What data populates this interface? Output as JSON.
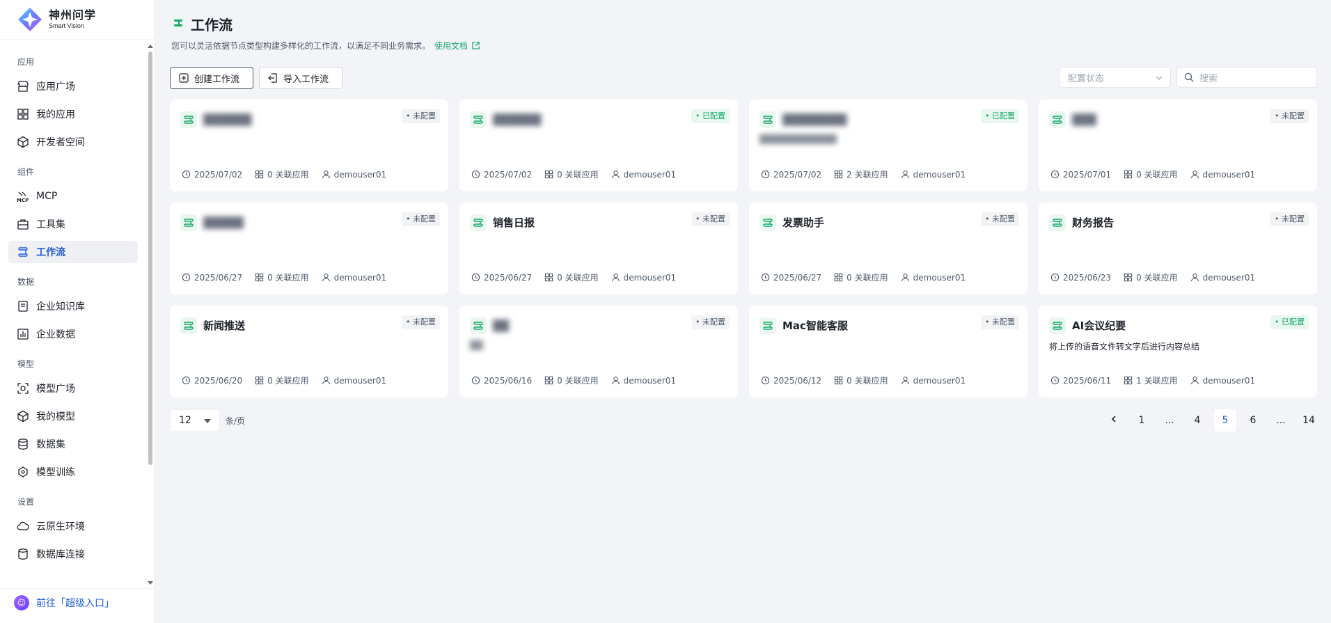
{
  "logo": {
    "cn": "神州问学",
    "en": "Smart Vision"
  },
  "sidebar": {
    "sections": [
      {
        "label": "应用",
        "items": [
          {
            "label": "应用广场",
            "icon": "store-icon"
          },
          {
            "label": "我的应用",
            "icon": "grid-icon"
          },
          {
            "label": "开发者空间",
            "icon": "cube-icon"
          }
        ]
      },
      {
        "label": "组件",
        "items": [
          {
            "label": "MCP",
            "icon": "mcp-icon"
          },
          {
            "label": "工具集",
            "icon": "toolbox-icon"
          },
          {
            "label": "工作流",
            "icon": "workflow-icon",
            "active": true
          }
        ]
      },
      {
        "label": "数据",
        "items": [
          {
            "label": "企业知识库",
            "icon": "book-icon"
          },
          {
            "label": "企业数据",
            "icon": "chart-icon"
          }
        ]
      },
      {
        "label": "模型",
        "items": [
          {
            "label": "模型广场",
            "icon": "model-square-icon"
          },
          {
            "label": "我的模型",
            "icon": "box-icon"
          },
          {
            "label": "数据集",
            "icon": "database-icon"
          },
          {
            "label": "模型训练",
            "icon": "training-icon"
          }
        ]
      },
      {
        "label": "设置",
        "items": [
          {
            "label": "云原生环境",
            "icon": "cloud-icon"
          },
          {
            "label": "数据库连接",
            "icon": "db-connect-icon"
          }
        ]
      }
    ],
    "super_entry": "前往「超级入口」"
  },
  "header": {
    "title": "工作流",
    "desc": "您可以灵活依据节点类型构建多样化的工作流，以满足不同业务需求。",
    "doc_link": "使用文档"
  },
  "toolbar": {
    "create_label": "创建工作流",
    "import_label": "导入工作流",
    "status_placeholder": "配置状态",
    "search_placeholder": "搜索"
  },
  "cards": [
    {
      "name": "██████",
      "blurred": true,
      "desc": "",
      "status": "未配置",
      "configured": false,
      "date": "2025/07/02",
      "apps": "0 关联应用",
      "user": "demouser01"
    },
    {
      "name": "██████",
      "blurred": true,
      "desc": "",
      "status": "已配置",
      "configured": true,
      "date": "2025/07/02",
      "apps": "0 关联应用",
      "user": "demouser01"
    },
    {
      "name": "████████",
      "blurred": true,
      "desc": "████████████",
      "desc_blurred": true,
      "status": "已配置",
      "configured": true,
      "date": "2025/07/02",
      "apps": "2 关联应用",
      "user": "demouser01"
    },
    {
      "name": "███",
      "blurred": true,
      "desc": "",
      "status": "未配置",
      "configured": false,
      "date": "2025/07/01",
      "apps": "0 关联应用",
      "user": "demouser01"
    },
    {
      "name": "█████",
      "blurred": true,
      "desc": "",
      "status": "未配置",
      "configured": false,
      "date": "2025/06/27",
      "apps": "0 关联应用",
      "user": "demouser01"
    },
    {
      "name": "销售日报",
      "blurred": false,
      "desc": "",
      "status": "未配置",
      "configured": false,
      "date": "2025/06/27",
      "apps": "0 关联应用",
      "user": "demouser01"
    },
    {
      "name": "发票助手",
      "blurred": false,
      "desc": "",
      "status": "未配置",
      "configured": false,
      "date": "2025/06/27",
      "apps": "0 关联应用",
      "user": "demouser01"
    },
    {
      "name": "财务报告",
      "blurred": false,
      "desc": "",
      "status": "未配置",
      "configured": false,
      "date": "2025/06/23",
      "apps": "0 关联应用",
      "user": "demouser01"
    },
    {
      "name": "新闻推送",
      "blurred": false,
      "desc": "",
      "status": "未配置",
      "configured": false,
      "date": "2025/06/20",
      "apps": "0 关联应用",
      "user": "demouser01"
    },
    {
      "name": "██",
      "blurred": true,
      "desc": "██",
      "desc_blurred": true,
      "status": "未配置",
      "configured": false,
      "date": "2025/06/16",
      "apps": "0 关联应用",
      "user": "demouser01"
    },
    {
      "name": "Mac智能客服",
      "blurred": false,
      "desc": "",
      "status": "未配置",
      "configured": false,
      "date": "2025/06/12",
      "apps": "0 关联应用",
      "user": "demouser01"
    },
    {
      "name": "AI会议纪要",
      "blurred": false,
      "desc": "将上传的语音文件转文字后进行内容总结",
      "status": "已配置",
      "configured": true,
      "date": "2025/06/11",
      "apps": "1 关联应用",
      "user": "demouser01"
    }
  ],
  "pagination": {
    "page_size": "12",
    "unit": "条/页",
    "pages": [
      "1",
      "...",
      "4",
      "5",
      "6",
      "...",
      "14"
    ],
    "current": "5"
  },
  "colors": {
    "accent": "#1e5ad8",
    "success": "#17a86b",
    "bg": "#f2f4f7"
  }
}
